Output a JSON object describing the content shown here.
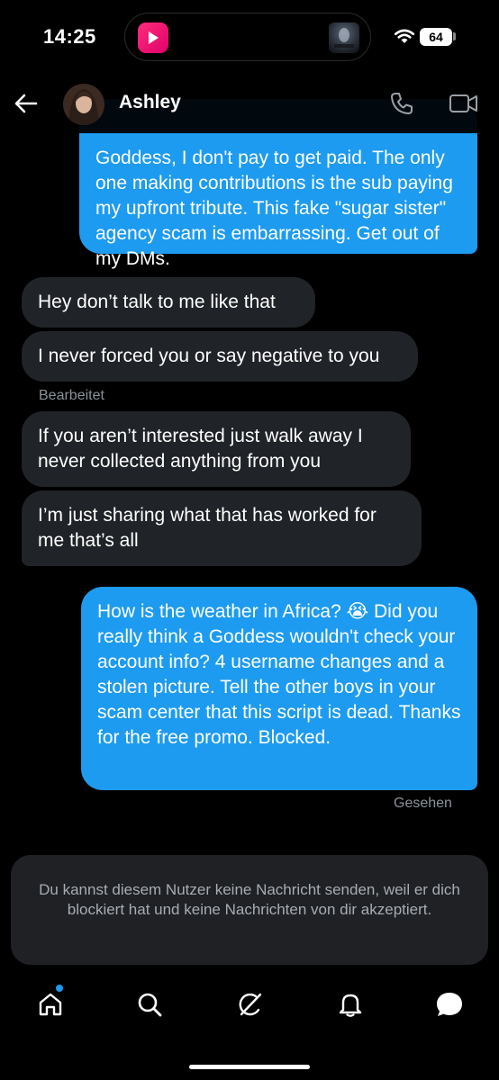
{
  "status_bar": {
    "time": "14:25",
    "battery": "64",
    "icons": [
      "app-badge-icon",
      "now-playing-artwork",
      "wifi-icon",
      "battery-icon"
    ]
  },
  "header": {
    "back_icon": "back-arrow-icon",
    "contact_name": "Ashley",
    "actions": [
      "phone-icon",
      "video-call-icon"
    ]
  },
  "messages": [
    {
      "side": "out",
      "text": "Goddess, I don't pay to get paid. The only one making contributions is the sub paying my upfront tribute. This fake \"sugar sister\" agency scam is embarrassing. Get out of my DMs."
    },
    {
      "side": "in",
      "text": "Hey don’t talk to me like that"
    },
    {
      "side": "in",
      "text": "I never forced you or say negative to you",
      "note": "Bearbeitet"
    },
    {
      "side": "in",
      "text": "If you aren’t interested just walk away I never collected anything from you"
    },
    {
      "side": "in",
      "text": "I’m just sharing what that has worked for me that’s all"
    },
    {
      "side": "out",
      "text": "How is the weather in Africa? 😭 Did you really think a Goddess wouldn't check your account info? 4 username changes and a stolen picture. Tell the other boys in your scam center that this script is dead. Thanks for the free promo. Blocked.",
      "note": "Gesehen"
    }
  ],
  "blocked_notice": "Du kannst diesem Nutzer keine Nachricht senden, weil er dich blockiert hat und keine Nachrichten von dir akzeptiert.",
  "bottom_nav": {
    "items": [
      "home-icon",
      "search-icon",
      "grok-icon",
      "notifications-bell-icon",
      "messages-icon"
    ],
    "unread_dot": true
  },
  "colors": {
    "background": "#000000",
    "outgoing_bubble": "#1d9bf0",
    "incoming_bubble": "#202327",
    "muted_text": "#8b9198"
  }
}
